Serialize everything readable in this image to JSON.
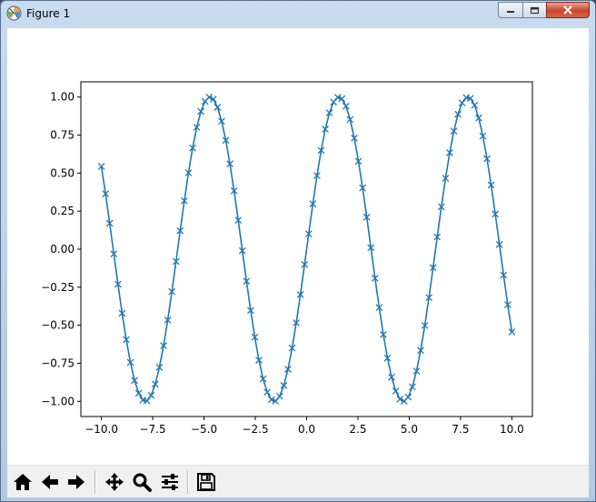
{
  "window": {
    "title": "Figure 1"
  },
  "toolbar": {
    "buttons": [
      {
        "name": "home-button",
        "icon": "home-icon"
      },
      {
        "name": "back-button",
        "icon": "arrow-left-icon"
      },
      {
        "name": "forward-button",
        "icon": "arrow-right-icon"
      },
      {
        "name": "pan-button",
        "icon": "move-icon"
      },
      {
        "name": "zoom-button",
        "icon": "magnifier-icon"
      },
      {
        "name": "configure-subplots-button",
        "icon": "sliders-icon"
      },
      {
        "name": "save-button",
        "icon": "floppy-disk-icon"
      }
    ]
  },
  "chart_data": {
    "type": "line",
    "title": "",
    "xlabel": "",
    "ylabel": "",
    "function": "sin(x)",
    "x_range": [
      -10,
      10
    ],
    "n_points": 100,
    "marker": "x",
    "line_color": "#1f77b4",
    "xlim": [
      -11,
      11
    ],
    "ylim": [
      -1.1,
      1.1
    ],
    "xticks": [
      -10,
      -7.5,
      -5,
      -2.5,
      0,
      2.5,
      5,
      7.5,
      10
    ],
    "xtick_labels": [
      "−10.0",
      "−7.5",
      "−5.0",
      "−2.5",
      "0.0",
      "2.5",
      "5.0",
      "7.5",
      "10.0"
    ],
    "yticks": [
      -1,
      -0.75,
      -0.5,
      -0.25,
      0,
      0.25,
      0.5,
      0.75,
      1
    ],
    "ytick_labels": [
      "−1.00",
      "−0.75",
      "−0.50",
      "−0.25",
      "0.00",
      "0.25",
      "0.50",
      "0.75",
      "1.00"
    ],
    "grid": false
  }
}
